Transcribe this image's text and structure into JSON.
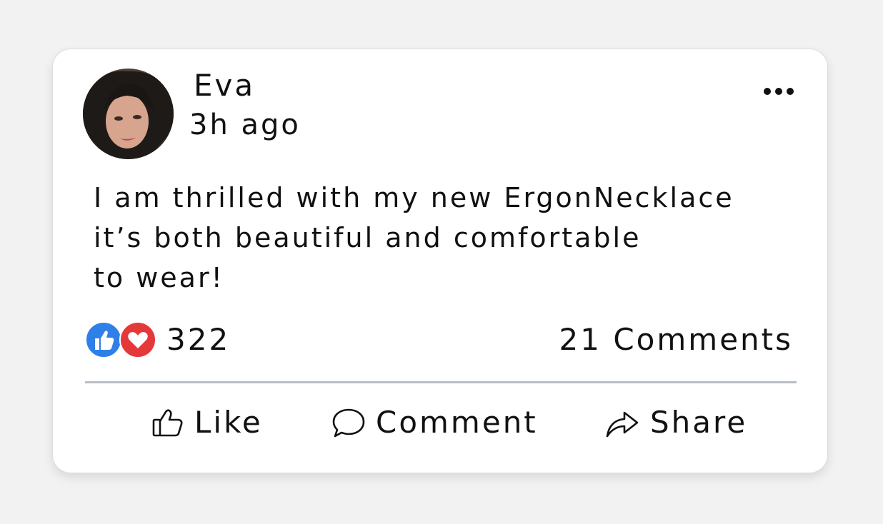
{
  "post": {
    "author": "Eva",
    "timestamp": "3h ago",
    "text_lines": [
      "I am thrilled with my new ErgonNecklace",
      "it’s both beautiful and comfortable",
      "to wear!"
    ]
  },
  "stats": {
    "reaction_count": "322",
    "comments_count": "21 Comments",
    "reaction_icons": [
      "thumbs-up-icon",
      "heart-icon"
    ]
  },
  "actions": {
    "like_label": "Like",
    "comment_label": "Comment",
    "share_label": "Share"
  },
  "colors": {
    "like_blue": "#2f7fe8",
    "love_red": "#e5383b",
    "divider": "#b7bec6",
    "background": "#f2f2f2"
  }
}
